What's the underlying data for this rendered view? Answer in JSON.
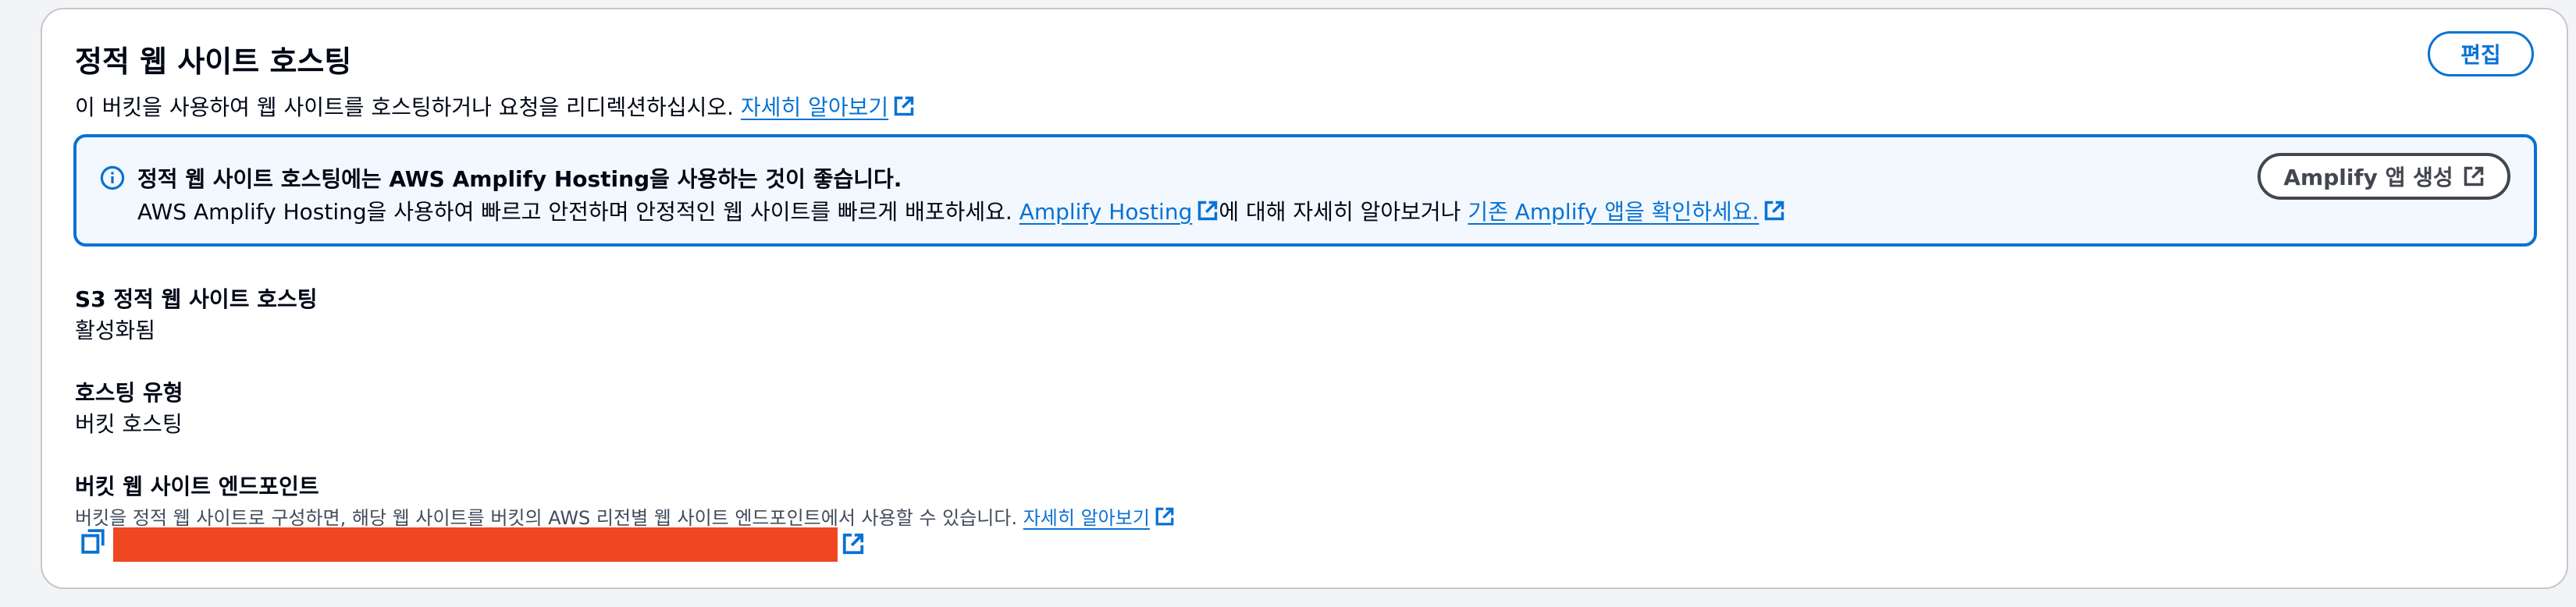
{
  "section": {
    "title": "정적 웹 사이트 호스팅",
    "description": "이 버킷을 사용하여 웹 사이트를 호스팅하거나 요청을 리디렉션하십시오.",
    "learn_more": "자세히 알아보기",
    "edit_label": "편집"
  },
  "alert": {
    "title": "정적 웹 사이트 호스팅에는 AWS Amplify Hosting을 사용하는 것이 좋습니다.",
    "body_prefix": "AWS Amplify Hosting을 사용하여 빠르고 안전하며 안정적인 웹 사이트를 빠르게 배포하세요.",
    "link1": "Amplify Hosting",
    "body_middle": "에 대해 자세히 알아보거나",
    "link2": "기존 Amplify 앱을 확인하세요.",
    "button_label": "Amplify 앱 생성"
  },
  "fields": {
    "static_hosting_label": "S3 정적 웹 사이트 호스팅",
    "static_hosting_value": "활성화됨",
    "hosting_type_label": "호스팅 유형",
    "hosting_type_value": "버킷 호스팅",
    "endpoint_label": "버킷 웹 사이트 엔드포인트",
    "endpoint_hint": "버킷을 정적 웹 사이트로 구성하면, 해당 웹 사이트를 버킷의 AWS 리전별 웹 사이트 엔드포인트에서 사용할 수 있습니다.",
    "endpoint_learn_more": "자세히 알아보기"
  },
  "icons": {
    "external": "external-link-icon",
    "info": "info-icon",
    "copy": "copy-icon"
  },
  "colors": {
    "link": "#0972d3",
    "alert_bg": "#f2f8fd",
    "redaction": "#ee4722"
  }
}
